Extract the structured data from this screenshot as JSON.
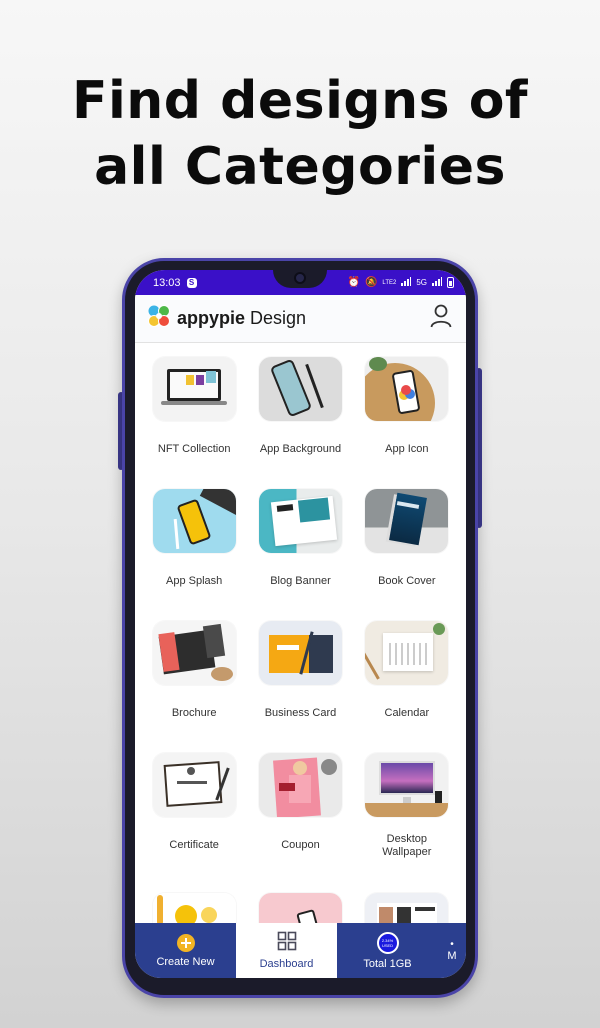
{
  "headline": {
    "line1": "Find designs of",
    "line2": "all Categories"
  },
  "statusbar": {
    "time": "13:03",
    "notification_icon": "s-app-icon",
    "network_label": "5G",
    "volte_label": "LTE2",
    "icons": [
      "alarm-icon",
      "mute-icon",
      "volte-icon",
      "signal-icon",
      "signal-icon",
      "battery-icon"
    ]
  },
  "appbar": {
    "brand_bold": "appypie",
    "brand_light": " Design",
    "profile_icon": "user-icon"
  },
  "categories": [
    {
      "label": "NFT Collection",
      "theme": "laptop"
    },
    {
      "label": "App Background",
      "theme": "phone-gray"
    },
    {
      "label": "App Icon",
      "theme": "phone-wood"
    },
    {
      "label": "App Splash",
      "theme": "phone-yellow"
    },
    {
      "label": "Blog Banner",
      "theme": "banner-teal"
    },
    {
      "label": "Book Cover",
      "theme": "book"
    },
    {
      "label": "Brochure",
      "theme": "brochure"
    },
    {
      "label": "Business Card",
      "theme": "card"
    },
    {
      "label": "Calendar",
      "theme": "calendar"
    },
    {
      "label": "Certificate",
      "theme": "certificate"
    },
    {
      "label": "Coupon",
      "theme": "coupon"
    },
    {
      "label": "Desktop Wallpaper",
      "theme": "desktop"
    },
    {
      "label": "",
      "theme": "emoji"
    },
    {
      "label": "",
      "theme": "pink-phone"
    },
    {
      "label": "",
      "theme": "flyer"
    }
  ],
  "bottomnav": {
    "items": [
      {
        "label": "Create New",
        "icon": "plus-circle-icon",
        "active": false
      },
      {
        "label": "Dashboard",
        "icon": "grid-icon",
        "active": true
      },
      {
        "label": "Total 1GB",
        "icon": "storage-usage-icon",
        "active": false,
        "usage_text": "2.34% USED"
      }
    ],
    "more_label": "M"
  },
  "colors": {
    "statusbar": "#3a10c8",
    "bottomnav": "#2b3f8f",
    "accent_yellow": "#f2b424",
    "phone_frame": "#4a44a8"
  }
}
